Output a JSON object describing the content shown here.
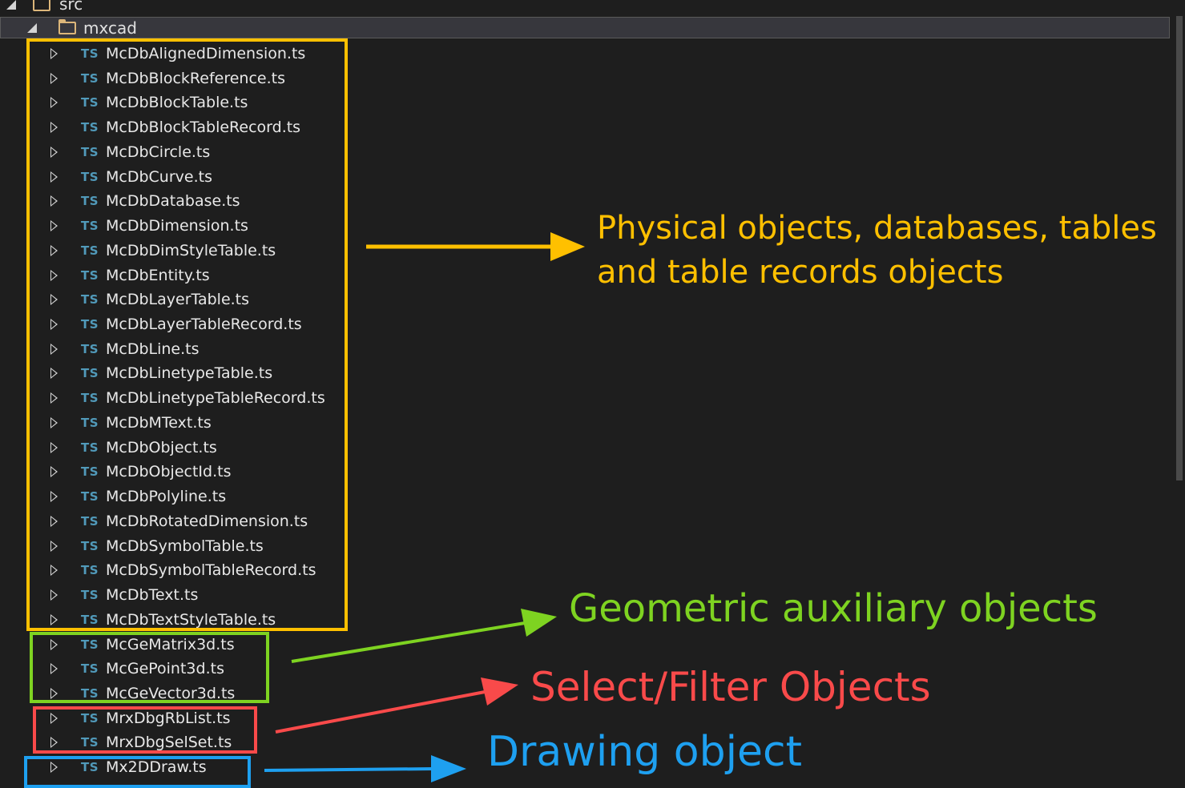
{
  "tree": {
    "src_label": "src",
    "mxcad_label": "mxcad",
    "file_icon_text": "TS",
    "files": [
      "McDbAlignedDimension.ts",
      "McDbBlockReference.ts",
      "McDbBlockTable.ts",
      "McDbBlockTableRecord.ts",
      "McDbCircle.ts",
      "McDbCurve.ts",
      "McDbDatabase.ts",
      "McDbDimension.ts",
      "McDbDimStyleTable.ts",
      "McDbEntity.ts",
      "McDbLayerTable.ts",
      "McDbLayerTableRecord.ts",
      "McDbLine.ts",
      "McDbLinetypeTable.ts",
      "McDbLinetypeTableRecord.ts",
      "McDbMText.ts",
      "McDbObject.ts",
      "McDbObjectId.ts",
      "McDbPolyline.ts",
      "McDbRotatedDimension.ts",
      "McDbSymbolTable.ts",
      "McDbSymbolTableRecord.ts",
      "McDbText.ts",
      "McDbTextStyleTable.ts",
      "McGeMatrix3d.ts",
      "McGePoint3d.ts",
      "McGeVector3d.ts",
      "MrxDbgRbList.ts",
      "MrxDbgSelSet.ts",
      "Mx2DDraw.ts"
    ]
  },
  "annotations": {
    "physical": "Physical objects, databases, tables and table records objects",
    "geometric": "Geometric auxiliary objects",
    "select": "Select/Filter Objects",
    "drawing": "Drawing object"
  },
  "colors": {
    "background": "#1e1e1e",
    "ts_icon": "#519aba",
    "folder": "#dcb67a",
    "physical": "#ffc000",
    "geometric": "#7ed321",
    "select": "#f94a4a",
    "drawing": "#1ea0f0"
  }
}
